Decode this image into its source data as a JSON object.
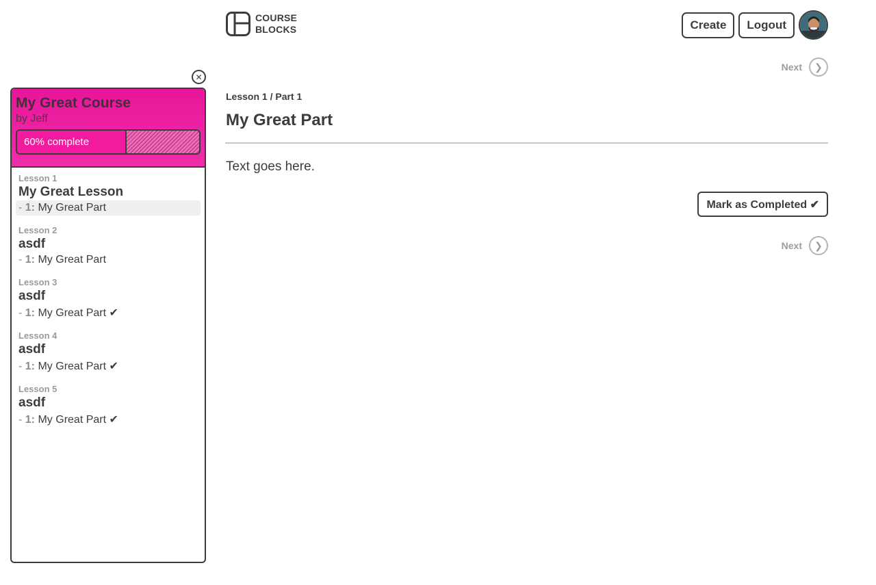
{
  "header": {
    "logo_line1": "COURSE",
    "logo_line2": "BLOCKS",
    "create_label": "Create",
    "logout_label": "Logout"
  },
  "navigation": {
    "next_label": "Next",
    "next_icon": "chevron-right-icon"
  },
  "sidebar": {
    "close_icon": "close-circle-icon",
    "course_title": "My Great Course",
    "course_author": "by Jeff",
    "progress_percent": 60,
    "progress_label": "60% complete",
    "lessons": [
      {
        "number": "Lesson 1",
        "title": "My Great Lesson",
        "parts": [
          {
            "dash": "- ",
            "num": "1:",
            "title": "My Great Part",
            "completed": "",
            "active": true
          }
        ]
      },
      {
        "number": "Lesson 2",
        "title": "asdf",
        "parts": [
          {
            "dash": "- ",
            "num": "1:",
            "title": "My Great Part",
            "completed": "",
            "active": false
          }
        ]
      },
      {
        "number": "Lesson 3",
        "title": "asdf",
        "parts": [
          {
            "dash": "- ",
            "num": "1:",
            "title": "My Great Part",
            "completed": "✔",
            "active": false
          }
        ]
      },
      {
        "number": "Lesson 4",
        "title": "asdf",
        "parts": [
          {
            "dash": "- ",
            "num": "1:",
            "title": "My Great Part",
            "completed": "✔",
            "active": false
          }
        ]
      },
      {
        "number": "Lesson 5",
        "title": "asdf",
        "parts": [
          {
            "dash": "- ",
            "num": "1:",
            "title": "My Great Part",
            "completed": "✔",
            "active": false
          }
        ]
      }
    ]
  },
  "main": {
    "breadcrumb": "Lesson 1 / Part 1",
    "title": "My Great Part",
    "body": "Text goes here.",
    "mark_completed_label": "Mark as Completed ✔"
  },
  "colors": {
    "accent_pink": "#f21a9f",
    "ink": "#3c3c3c",
    "muted": "#9a9a9a"
  }
}
